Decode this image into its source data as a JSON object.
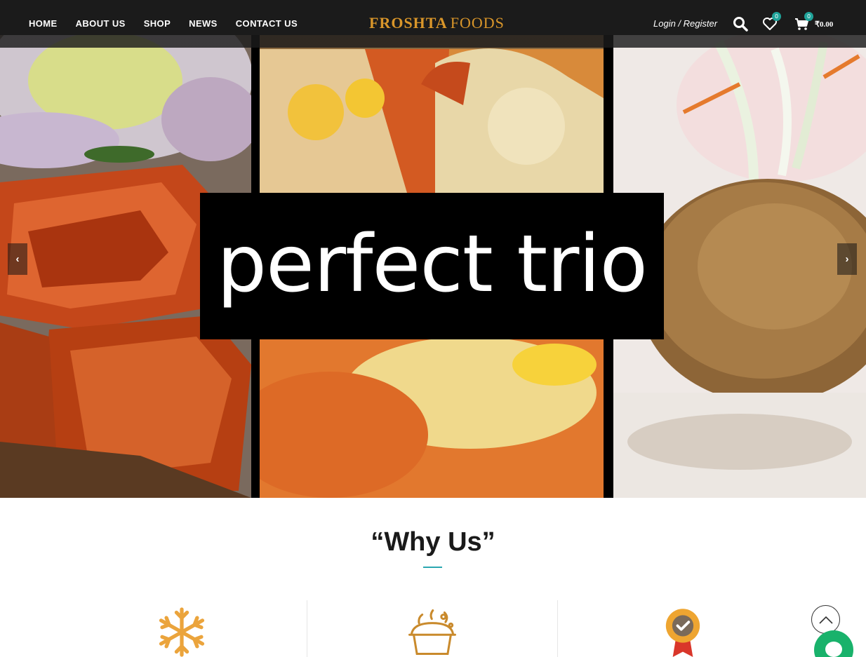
{
  "header": {
    "nav": [
      "HOME",
      "ABOUT US",
      "SHOP",
      "NEWS",
      "CONTACT US"
    ],
    "logo_word1": "FROSHTA",
    "logo_word2": "FOODS",
    "login_label": "Login / Register",
    "wishlist_count": "0",
    "cart_count": "0",
    "cart_total": "₹0.00"
  },
  "hero": {
    "title": "perfect trio",
    "prev_arrow": "‹",
    "next_arrow": "›"
  },
  "why_us": {
    "title": "“Why Us”"
  },
  "colors": {
    "header_bg": "#1b1b1b",
    "accent_gold": "#d9962a",
    "badge_teal": "#1fa39a",
    "underline_teal": "#2aa7b0",
    "chat_green": "#19b26b"
  },
  "icons": {
    "search": "search-icon",
    "wishlist": "heart-icon",
    "cart": "cart-icon",
    "feature1": "snowflake-icon",
    "feature2": "cooking-pan-icon",
    "feature3": "quality-medal-icon"
  }
}
